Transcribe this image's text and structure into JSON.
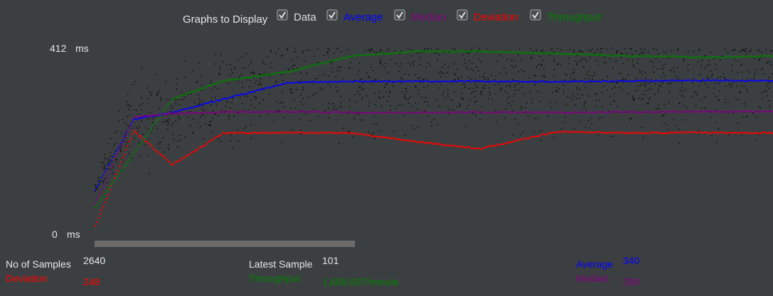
{
  "header": {
    "label": "Graphs to Display"
  },
  "checkboxes": [
    {
      "label": "Data",
      "checked": true,
      "color": "#dcdcdc"
    },
    {
      "label": "Average",
      "checked": true,
      "color": "#0000ff"
    },
    {
      "label": "Median",
      "checked": true,
      "color": "#800080"
    },
    {
      "label": "Deviation",
      "checked": true,
      "color": "#ff0000"
    },
    {
      "label": "Throughput",
      "checked": true,
      "color": "#008000"
    }
  ],
  "axis": {
    "top_label": "412",
    "bottom_label": "0",
    "unit": "ms"
  },
  "stats": {
    "samples_label": "No of Samples",
    "samples_value": "2640",
    "deviation_label": "Deviation",
    "deviation_value": "248",
    "latest_label": "Latest Sample",
    "latest_value": "101",
    "throughput_label": "Throughput",
    "throughput_value": "1,689,997/minute",
    "average_label": "Average",
    "average_value": "340",
    "median_label": "Median",
    "median_value": "288"
  },
  "colors": {
    "background": "#3c3f41",
    "text": "#e6e6e6",
    "average": "#0000ff",
    "median": "#800080",
    "deviation": "#ff0000",
    "throughput": "#008000",
    "data": "#000000",
    "scrollbar": "#6b6b6b"
  },
  "chart_data": {
    "type": "scatter",
    "ylim": [
      0,
      412
    ],
    "yunit": "ms",
    "x": [
      0,
      150,
      300,
      500,
      750,
      1000,
      1250,
      1500,
      1800,
      2100,
      2400,
      2640
    ],
    "series": [
      {
        "name": "Average",
        "values": [
          100,
          255,
          270,
          300,
          336,
          339,
          339,
          339,
          338,
          340,
          341,
          340
        ]
      },
      {
        "name": "Median",
        "values": [
          70,
          260,
          268,
          271,
          272,
          270,
          270,
          271,
          270,
          271,
          272,
          272
        ]
      },
      {
        "name": "Deviation",
        "values": [
          20,
          230,
          155,
          225,
          226,
          225,
          206,
          190,
          228,
          225,
          226,
          225
        ]
      },
      {
        "name": "Throughput",
        "values": [
          60,
          180,
          300,
          340,
          360,
          395,
          405,
          405,
          400,
          395,
          392,
          395
        ]
      }
    ]
  }
}
